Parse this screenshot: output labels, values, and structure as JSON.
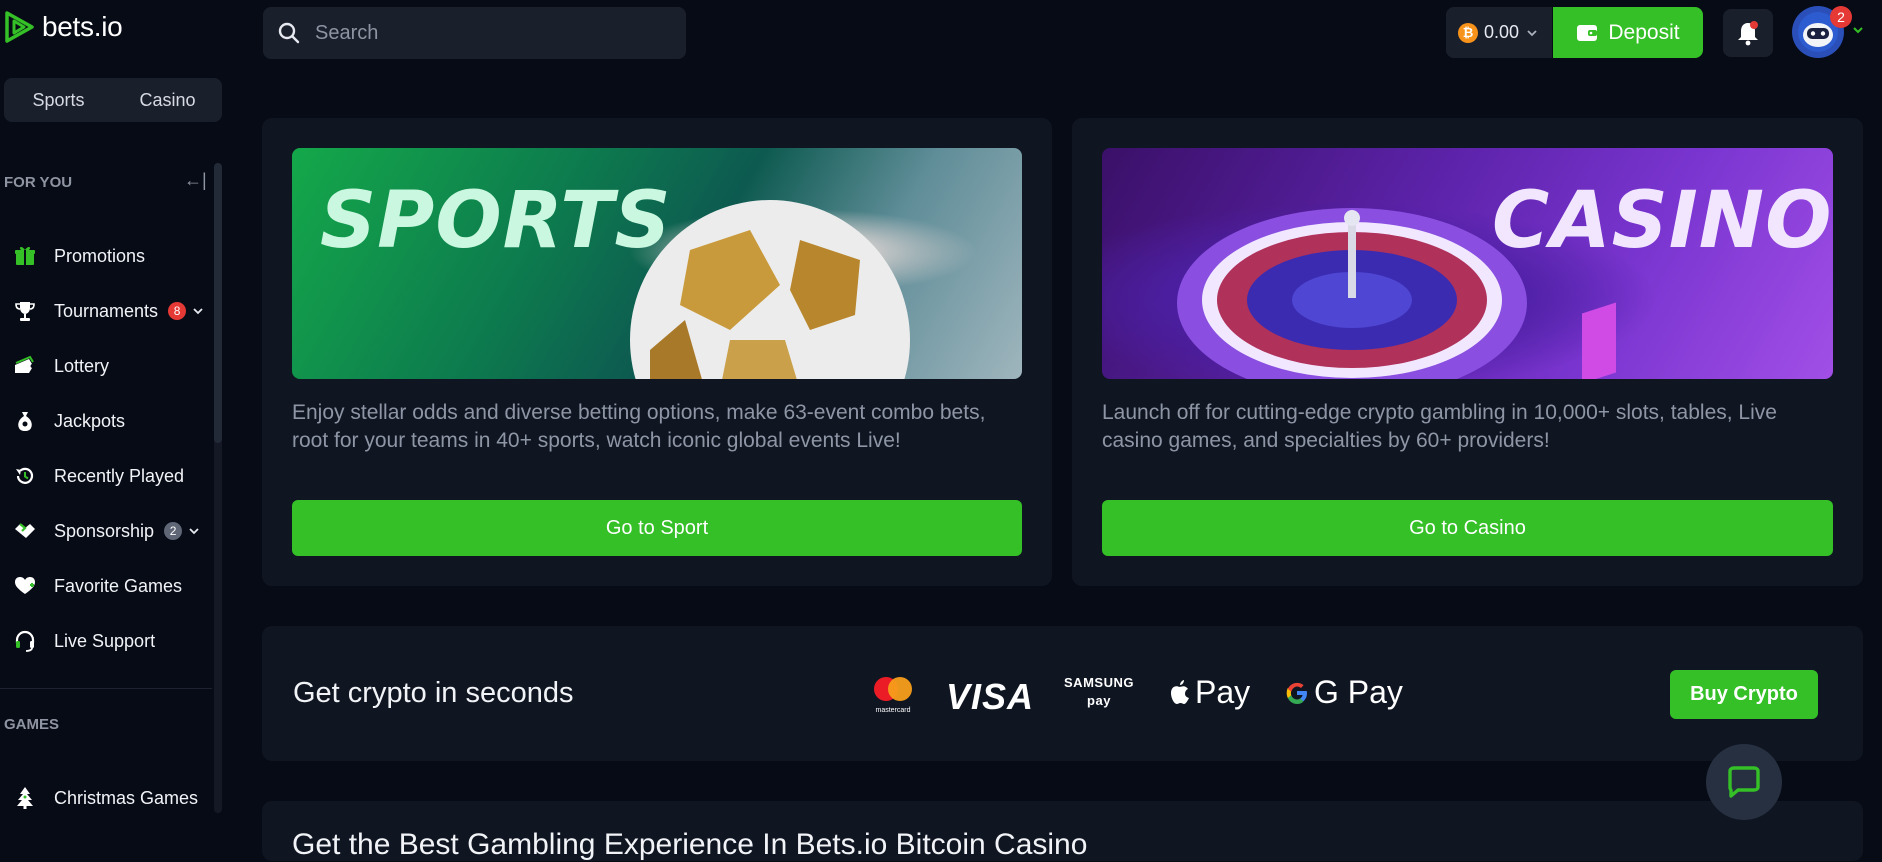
{
  "brand": {
    "name": "bets.io"
  },
  "header": {
    "search_placeholder": "Search",
    "balance": "0.00",
    "currency_icon": "bitcoin-icon",
    "deposit_label": "Deposit",
    "notification_count": "2"
  },
  "sidebar": {
    "tabs": [
      "Sports",
      "Casino"
    ],
    "for_you_heading": "FOR YOU",
    "items": [
      {
        "label": "Promotions",
        "icon": "gift-icon"
      },
      {
        "label": "Tournaments",
        "icon": "trophy-icon",
        "badge": "8"
      },
      {
        "label": "Lottery",
        "icon": "ticket-icon"
      },
      {
        "label": "Jackpots",
        "icon": "money-bag-icon"
      },
      {
        "label": "Recently Played",
        "icon": "history-icon"
      },
      {
        "label": "Sponsorship",
        "icon": "handshake-icon",
        "badge": "2"
      },
      {
        "label": "Favorite Games",
        "icon": "heart-icon"
      },
      {
        "label": "Live Support",
        "icon": "headset-icon"
      }
    ],
    "games_heading": "GAMES",
    "games_items": [
      {
        "label": "Christmas Games",
        "icon": "christmas-tree-icon"
      }
    ]
  },
  "sports_card": {
    "banner_text": "SPORTS",
    "description": "Enjoy stellar odds and diverse betting options, make 63-event combo bets, root for your teams in 40+ sports, watch iconic global events Live!",
    "button": "Go to Sport"
  },
  "casino_card": {
    "banner_text": "CASINO",
    "description": "Launch off for cutting-edge crypto gambling in 10,000+ slots, tables, Live casino games, and specialties by 60+ providers!",
    "button": "Go to Casino"
  },
  "crypto_banner": {
    "title": "Get crypto in seconds",
    "payment_logos": [
      "mastercard",
      "VISA",
      "SAMSUNG pay",
      "Pay",
      "G Pay"
    ],
    "button": "Buy Crypto"
  },
  "bottom_section": {
    "title_partial": "Get the Best Gambling Experience In Bets.io Bitcoin Casino"
  },
  "colors": {
    "accent": "#34c026",
    "background": "#070b16",
    "card": "#0f1521",
    "badge_red": "#e53935",
    "badge_gray": "#5f6675"
  }
}
